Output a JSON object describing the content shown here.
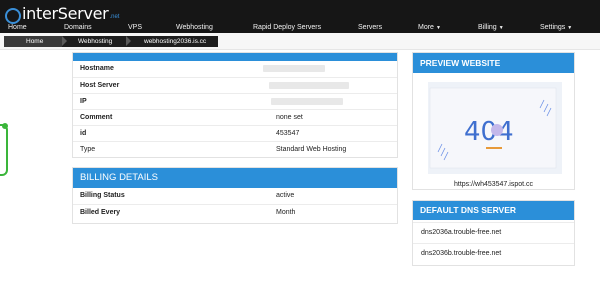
{
  "brand": {
    "name": "interServer",
    "tld": ".net"
  },
  "nav": [
    {
      "label": "Home",
      "caret": false
    },
    {
      "label": "Domains",
      "caret": false
    },
    {
      "label": "VPS",
      "caret": false
    },
    {
      "label": "Webhosting",
      "caret": false
    },
    {
      "label": "Rapid Deploy Servers",
      "caret": false
    },
    {
      "label": "Servers",
      "caret": false
    },
    {
      "label": "More",
      "caret": true
    },
    {
      "label": "Billing",
      "caret": true
    },
    {
      "label": "Settings",
      "caret": true
    }
  ],
  "breadcrumb": [
    "Home",
    "Webhosting",
    "webhosting2036.is.cc"
  ],
  "details": {
    "rows": [
      {
        "label": "Hostname",
        "value": ""
      },
      {
        "label": "Host Server",
        "value": ""
      },
      {
        "label": "IP",
        "value": ""
      },
      {
        "label": "Comment",
        "value": "none set"
      },
      {
        "label": "id",
        "value": "453547"
      },
      {
        "label": "Type",
        "value": "Standard Web Hosting"
      }
    ]
  },
  "billing": {
    "title": "BILLING DETAILS",
    "rows": [
      {
        "label": "Billing Status",
        "value": "active"
      },
      {
        "label": "Billed Every",
        "value": "Month"
      }
    ]
  },
  "preview": {
    "title": "PREVIEW WEBSITE",
    "image_text": "404",
    "url": "https://wh453547.ispot.cc"
  },
  "dns": {
    "title": "DEFAULT DNS SERVER",
    "servers": [
      "dns2036a.trouble-free.net",
      "dns2036b.trouble-free.net"
    ]
  },
  "colors": {
    "accent": "#2b8fd9",
    "topbar": "#161616",
    "status": "#3ab53a"
  }
}
